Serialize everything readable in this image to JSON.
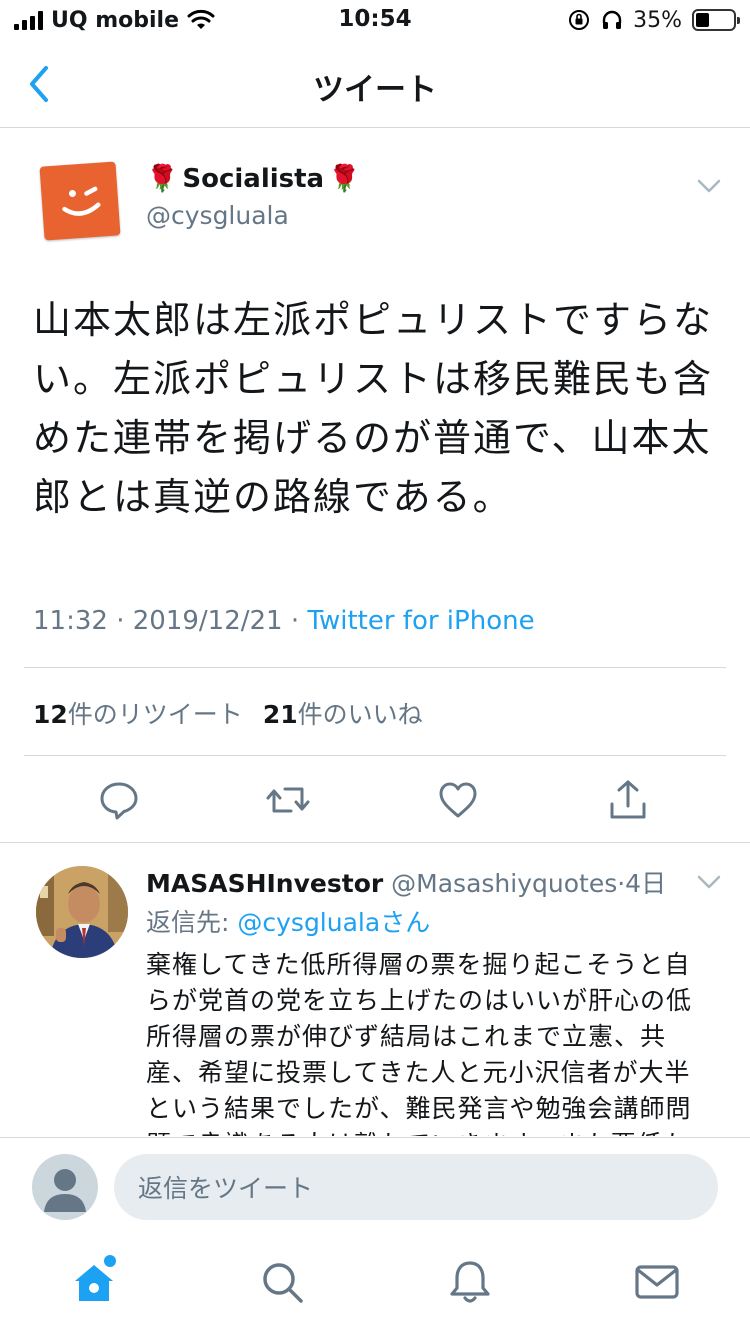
{
  "status_bar": {
    "carrier": "UQ mobile",
    "time": "10:54",
    "battery": "35%",
    "battery_level": 0.35
  },
  "nav": {
    "title": "ツイート"
  },
  "tweet": {
    "display_name": "Socialista",
    "name_emoji": "🌹",
    "username": "@cysgluala",
    "text": "山本太郎は左派ポピュリストですらない。左派ポピュリストは移民難民も含めた連帯を掲げるのが普通で、山本太郎とは真逆の路線である。",
    "time": "11:32",
    "date": "2019/12/21",
    "separator": "·",
    "source": "Twitter for iPhone",
    "retweet_count": "12",
    "retweet_label": "件のリツイート",
    "like_count": "21",
    "like_label": "件のいいね"
  },
  "reply": {
    "name": "MASASHInvestor",
    "handle": "@Masashiyquotes",
    "separator": "·",
    "age": "4日",
    "reply_to_label": "返信先: ",
    "reply_to_user": "@cysgluala",
    "reply_to_suffix": "さん",
    "text": "棄権してきた低所得層の票を掘り起こそうと自らが党首の党を立ち上げたのはいいが肝心の低所得層の票が伸びず結局はこれまで立憲、共産、希望に投票してきた人と元小沢信者が大半という結果でしたが、難民発言や勉強会講師問題で良識ある人は離れていきます。また票低たす"
  },
  "reply_bar": {
    "placeholder": "返信をツイート"
  },
  "colors": {
    "accent": "#1da1f2",
    "secondary_text": "#657786",
    "divider": "#d6d9db",
    "avatar_orange": "#e8632f"
  },
  "icons": [
    "back-icon",
    "caret-down-icon",
    "reply-icon",
    "retweet-icon",
    "like-icon",
    "share-icon",
    "home-icon",
    "search-icon",
    "notifications-icon",
    "messages-icon"
  ]
}
